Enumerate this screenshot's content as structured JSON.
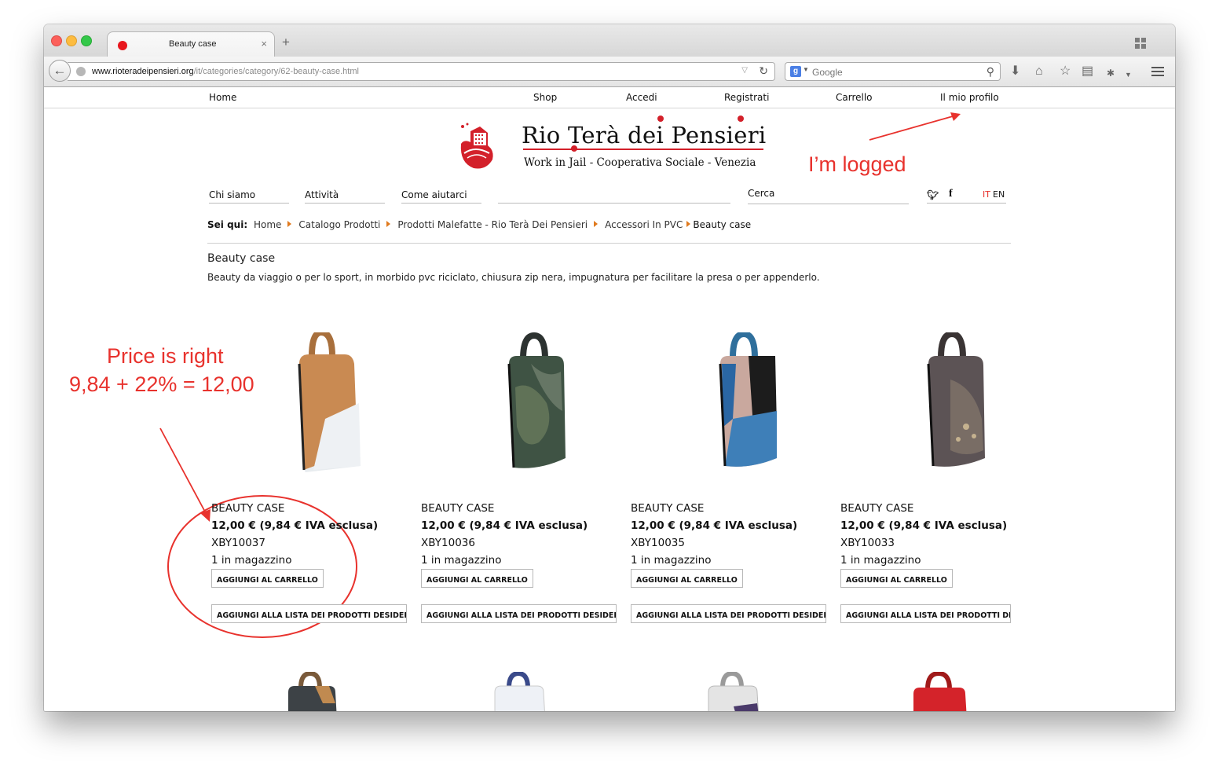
{
  "browser": {
    "tab_title": "Beauty case",
    "tab_close": "×",
    "new_tab": "+",
    "url_host": "www.rioteradeipensieri.org",
    "url_path": "/it/categories/category/62-beauty-case.html",
    "search_placeholder": "Google",
    "search_engine_badge": "g",
    "icons": [
      "back-arrow-icon",
      "globe-icon",
      "reload-icon",
      "search-icon",
      "download-icon",
      "home-icon",
      "bookmark-star-icon",
      "reading-list-icon",
      "addon-icon",
      "menu-icon",
      "tab-groups-icon"
    ]
  },
  "top_menu": {
    "home": "Home",
    "shop": "Shop",
    "login": "Accedi",
    "register": "Registrati",
    "cart": "Carrello",
    "profile": "Il mio profilo"
  },
  "logo": {
    "title": "Rio Terà dei Pensieri",
    "subtitle": "Work in Jail - Cooperativa Sociale - Venezia"
  },
  "secondary_nav": {
    "about": "Chi siamo",
    "activities": "Attività",
    "help": "Come aiutarci",
    "search_label": "Cerca",
    "lang_it": "IT",
    "lang_en": "EN"
  },
  "breadcrumb": {
    "label": "Sei qui:",
    "items": [
      "Home",
      "Catalogo Prodotti",
      "Prodotti Malefatte - Rio Terà Dei Pensieri",
      "Accessori In PVC"
    ],
    "current": "Beauty case"
  },
  "category": {
    "title": "Beauty case",
    "description": "Beauty da viaggio o per lo sport, in morbido pvc riciclato, chiusura zip nera, impugnatura per facilitare la presa o per appenderlo."
  },
  "products": [
    {
      "name": "BEAUTY CASE",
      "price": "12,00 € (9,84 € IVA esclusa)",
      "sku": "XBY10037",
      "stock": "1 in magazzino",
      "cart_button": "AGGIUNGI AL CARRELLO",
      "wishlist_button": "AGGIUNGI ALLA LISTA DEI PRODOTTI DESIDERATI"
    },
    {
      "name": "BEAUTY CASE",
      "price": "12,00 € (9,84 € IVA esclusa)",
      "sku": "XBY10036",
      "stock": "1 in magazzino",
      "cart_button": "AGGIUNGI AL CARRELLO",
      "wishlist_button": "AGGIUNGI ALLA LISTA DEI PRODOTTI DESIDERATI"
    },
    {
      "name": "BEAUTY CASE",
      "price": "12,00 € (9,84 € IVA esclusa)",
      "sku": "XBY10035",
      "stock": "1 in magazzino",
      "cart_button": "AGGIUNGI AL CARRELLO",
      "wishlist_button": "AGGIUNGI ALLA LISTA DEI PRODOTTI DESIDERATI"
    },
    {
      "name": "BEAUTY CASE",
      "price": "12,00 € (9,84 € IVA esclusa)",
      "sku": "XBY10033",
      "stock": "1 in magazzino",
      "cart_button": "AGGIUNGI AL CARRELLO",
      "wishlist_button": "AGGIUNGI ALLA LISTA DEI PRODOTTI DESIDERATI"
    }
  ],
  "annotations": {
    "logged": "I’m logged",
    "price_line1": "Price is right",
    "price_line2": "9,84 + 22% = 12,00"
  },
  "colors": {
    "brand_red": "#d3202a",
    "annotation_red": "#e8322d",
    "breadcrumb_arrow": "#e07a1e"
  }
}
